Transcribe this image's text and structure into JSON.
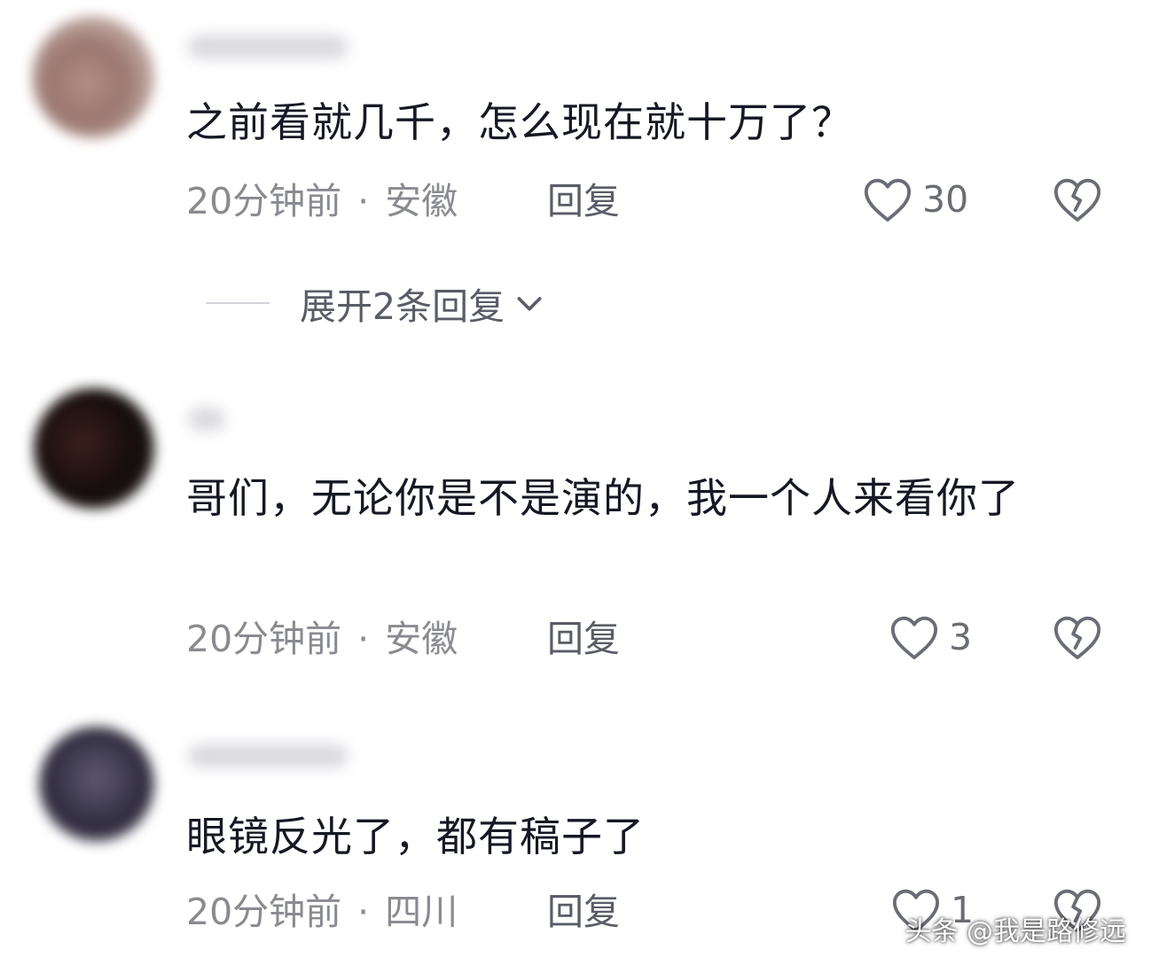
{
  "comments": [
    {
      "text": "之前看就几千，怎么现在就十万了？",
      "time": "20分钟前",
      "location": "安徽",
      "reply_label": "回复",
      "likes": "30",
      "expand_label": "展开2条回复"
    },
    {
      "text": "哥们，无论你是不是演的，我一个人来看你了",
      "time": "20分钟前",
      "location": "安徽",
      "reply_label": "回复",
      "likes": "3"
    },
    {
      "text": "眼镜反光了，都有稿子了",
      "time": "20分钟前",
      "location": "四川",
      "reply_label": "回复",
      "likes": "1"
    }
  ],
  "separator": "·",
  "watermark": "头条 @我是路修远",
  "icons": {
    "like": "heart-outline-icon",
    "dislike": "broken-heart-icon",
    "expand": "chevron-down-icon"
  },
  "colors": {
    "text": "#161823",
    "meta": "#8a8b91",
    "icon": "#6b6d75"
  }
}
